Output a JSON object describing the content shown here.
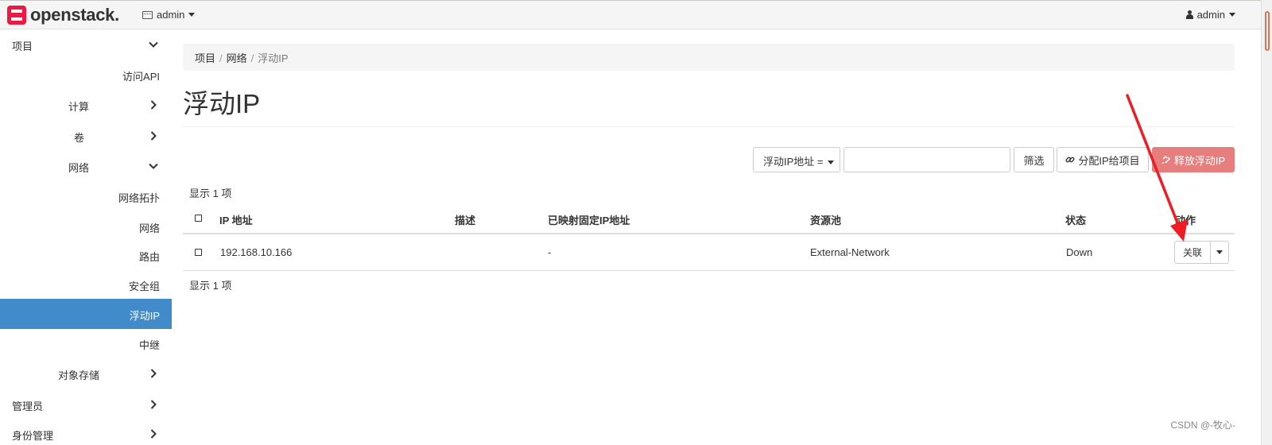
{
  "brand": {
    "text": "openstack."
  },
  "topbar": {
    "project_label": "admin",
    "user_label": "admin"
  },
  "sidebar": {
    "items": [
      {
        "label": "项目",
        "chevron": "down"
      },
      {
        "label": "访问API",
        "chevron": ""
      },
      {
        "label": "计算",
        "chevron": "right"
      },
      {
        "label": "卷",
        "chevron": "right"
      },
      {
        "label": "网络",
        "chevron": "down"
      },
      {
        "label": "网络拓扑",
        "chevron": ""
      },
      {
        "label": "网络",
        "chevron": ""
      },
      {
        "label": "路由",
        "chevron": ""
      },
      {
        "label": "安全组",
        "chevron": ""
      },
      {
        "label": "浮动IP",
        "chevron": "",
        "active": true
      },
      {
        "label": "中继",
        "chevron": ""
      },
      {
        "label": "对象存储",
        "chevron": "right"
      },
      {
        "label": "管理员",
        "chevron": "right"
      },
      {
        "label": "身份管理",
        "chevron": "right"
      }
    ]
  },
  "breadcrumb": {
    "items": [
      "项目",
      "网络",
      "浮动IP"
    ]
  },
  "page": {
    "title": "浮动IP"
  },
  "toolbar": {
    "filter_select": "浮动IP地址 =",
    "filter_input_value": "",
    "filter_button": "筛选",
    "allocate_button": "分配IP给项目",
    "release_button": "释放浮动IP"
  },
  "table": {
    "count_label": "显示 1 项",
    "columns": [
      "IP 地址",
      "描述",
      "已映射固定IP地址",
      "资源池",
      "状态",
      "动作"
    ],
    "rows": [
      {
        "ip": "192.168.10.166",
        "description": "",
        "fixed_ip": "-",
        "pool": "External-Network",
        "status": "Down",
        "action": "关联"
      }
    ]
  },
  "watermark": "CSDN @-牧心-",
  "colors": {
    "active": "#428bca",
    "danger": "#e57e7c",
    "arrow": "#ee1c24"
  }
}
